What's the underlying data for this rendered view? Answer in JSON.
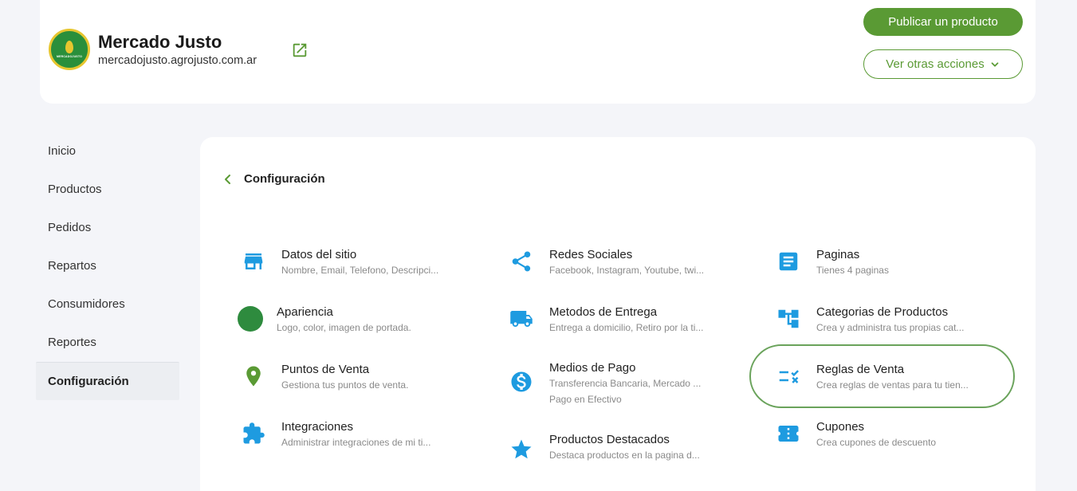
{
  "header": {
    "store_name": "Mercado Justo",
    "store_url": "mercadojusto.agrojusto.com.ar",
    "logo_text": "MERCADOJUSTO",
    "publish_label": "Publicar un producto",
    "more_label": "Ver otras acciones"
  },
  "sidebar": {
    "items": [
      {
        "label": "Inicio"
      },
      {
        "label": "Productos"
      },
      {
        "label": "Pedidos"
      },
      {
        "label": "Repartos"
      },
      {
        "label": "Consumidores"
      },
      {
        "label": "Reportes"
      },
      {
        "label": "Configuración"
      }
    ]
  },
  "main": {
    "title": "Configuración",
    "options": [
      {
        "title": "Datos del sitio",
        "subtitle": "Nombre, Email, Telefono, Descripci...",
        "icon": "store-icon"
      },
      {
        "title": "Redes Sociales",
        "subtitle": "Facebook, Instagram, Youtube, twi...",
        "icon": "share-icon"
      },
      {
        "title": "Paginas",
        "subtitle": "Tienes 4 paginas",
        "icon": "document-icon"
      },
      {
        "title": "Apariencia",
        "subtitle": "Logo, color, imagen de portada.",
        "icon": "color-circle-icon"
      },
      {
        "title": "Metodos de Entrega",
        "subtitle": "Entrega a domicilio, Retiro por la ti...",
        "icon": "truck-icon"
      },
      {
        "title": "Categorias de Productos",
        "subtitle": "Crea y administra tus propias cat...",
        "icon": "category-tree-icon"
      },
      {
        "title": "Puntos de Venta",
        "subtitle": "Gestiona tus puntos de venta.",
        "icon": "location-pin-icon"
      },
      {
        "title": "Medios de Pago",
        "subtitle": "Transferencia Bancaria, Mercado ...",
        "subtitle2": "Pago en Efectivo",
        "icon": "dollar-icon"
      },
      {
        "title": "Reglas de Venta",
        "subtitle": "Crea reglas de ventas para tu tien...",
        "icon": "rules-icon"
      },
      {
        "title": "Integraciones",
        "subtitle": "Administrar integraciones de mi ti...",
        "icon": "puzzle-icon"
      },
      {
        "title": "Productos Destacados",
        "subtitle": "Destaca productos en la pagina d...",
        "icon": "star-icon"
      },
      {
        "title": "Cupones",
        "subtitle": "Crea cupones de descuento",
        "icon": "coupon-icon"
      }
    ]
  },
  "colors": {
    "brand_green": "#5a9a34",
    "icon_blue": "#1e9be0",
    "appearance_green": "#2e8b3e",
    "pin_green": "#5a9a34",
    "highlight": "#6aa35b"
  }
}
